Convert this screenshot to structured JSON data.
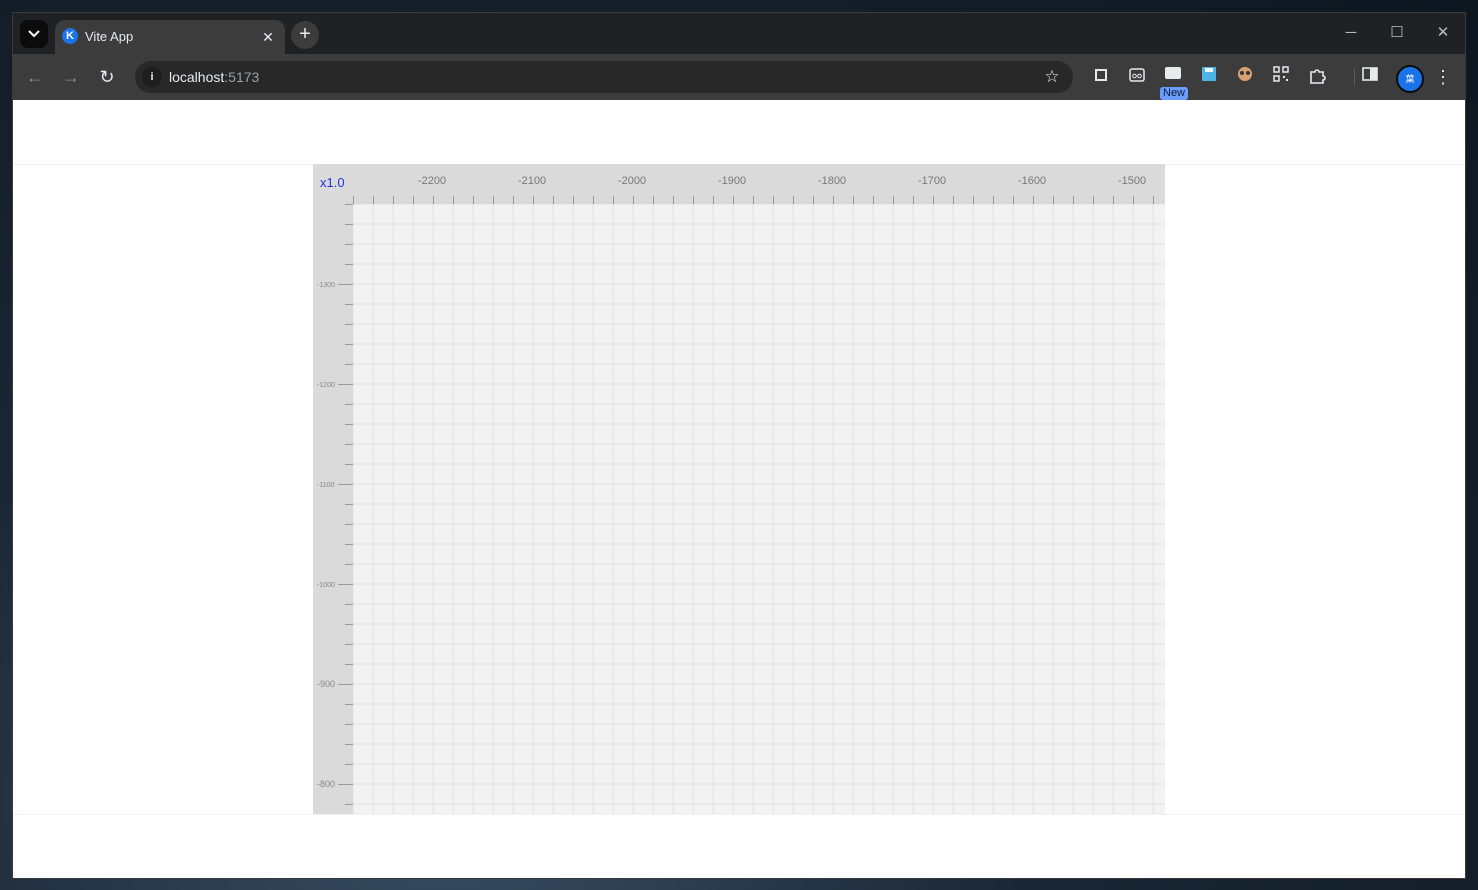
{
  "browser": {
    "tab": {
      "title": "Vite App",
      "favicon_letter": "K"
    },
    "address": {
      "host": "localhost",
      "port": ":5173"
    },
    "extensions_badge": "New",
    "profile_initials": "葉"
  },
  "editor": {
    "zoom_label": "x1.0",
    "ruler_x": {
      "labels": [
        "-2200",
        "-2100",
        "-2000",
        "-1900",
        "-1800",
        "-1700",
        "-1600",
        "-1500"
      ]
    },
    "ruler_y": {
      "labels": [
        "-1300",
        "-1200",
        "-1100",
        "-1000",
        "-900",
        "-800"
      ]
    }
  },
  "icons": {
    "tab_search": "chevron-down-icon",
    "close": "close-icon",
    "new_tab": "plus-icon",
    "back": "back-arrow-icon",
    "forward": "forward-arrow-icon",
    "reload": "reload-icon",
    "info": "info-icon",
    "bookmark": "star-icon"
  }
}
